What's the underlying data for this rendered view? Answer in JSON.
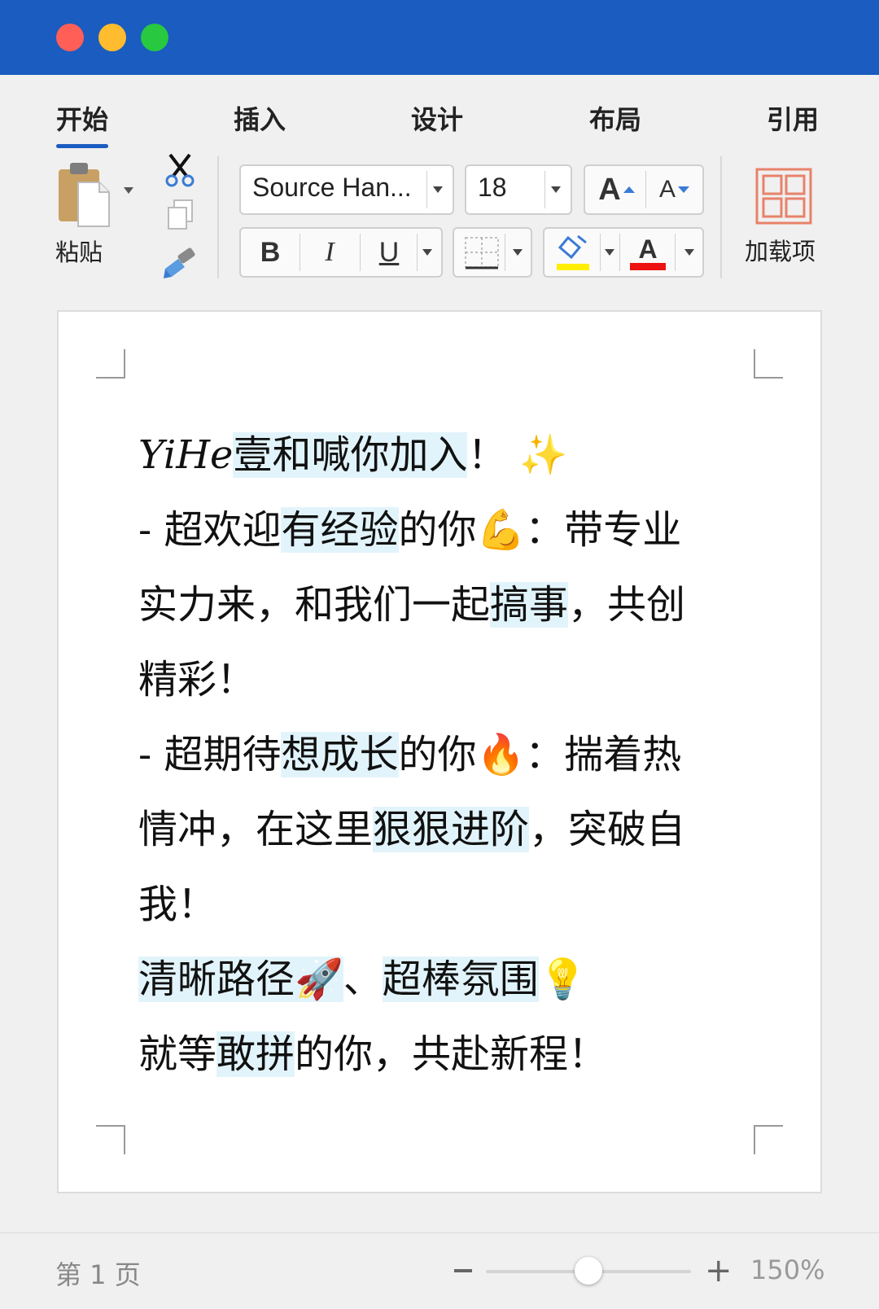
{
  "window": {
    "controls": [
      "close",
      "minimize",
      "maximize"
    ],
    "titlebar_color": "#1a5cc0"
  },
  "tabs": [
    {
      "label": "开始",
      "active": true
    },
    {
      "label": "插入"
    },
    {
      "label": "设计"
    },
    {
      "label": "布局"
    },
    {
      "label": "引用"
    }
  ],
  "ribbon": {
    "paste_label": "粘贴",
    "font_name": "Source Han...",
    "font_size": "18",
    "grow_font": "A",
    "shrink_font": "A",
    "bold": "B",
    "italic": "I",
    "underline": "U",
    "font_color_letter": "A",
    "highlight_color": "#ffee00",
    "font_color": "#ee1111",
    "addins_label": "加载项"
  },
  "document": {
    "lines": [
      [
        {
          "t": "YiHe",
          "style": "brand"
        },
        {
          "t": "壹和喊你加入",
          "hl": true
        },
        {
          "t": "！ ✨"
        }
      ],
      [
        {
          "t": "- 超欢迎"
        },
        {
          "t": "有经验",
          "hl": true
        },
        {
          "t": "的你💪：带专业"
        }
      ],
      [
        {
          "t": "实力来，和我们一起"
        },
        {
          "t": "搞事",
          "hl": true
        },
        {
          "t": "，共创"
        }
      ],
      [
        {
          "t": "精彩！"
        }
      ],
      [
        {
          "t": "- 超期待"
        },
        {
          "t": "想成长",
          "hl": true
        },
        {
          "t": "的你🔥：揣着热"
        }
      ],
      [
        {
          "t": "情冲，在这里"
        },
        {
          "t": "狠狠进阶",
          "hl": true
        },
        {
          "t": "，突破自"
        }
      ],
      [
        {
          "t": "我！"
        }
      ],
      [
        {
          "t": "清晰路径🚀",
          "hl": true
        },
        {
          "t": "、"
        },
        {
          "t": "超棒氛围",
          "hl": true
        },
        {
          "t": "💡"
        }
      ],
      [
        {
          "t": "就等"
        },
        {
          "t": "敢拼",
          "hl": true
        },
        {
          "t": "的你，共赴新程！"
        }
      ]
    ]
  },
  "status": {
    "page_indicator": "第 1 页",
    "zoom_level": "150%",
    "zoom_fraction": 0.5
  }
}
